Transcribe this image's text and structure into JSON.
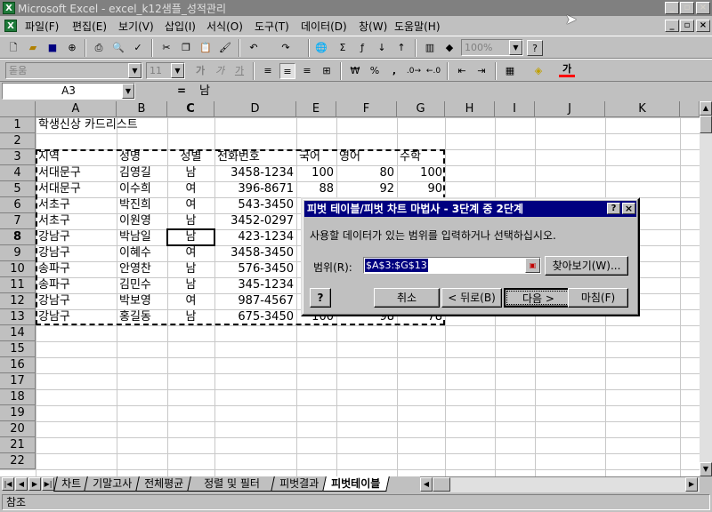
{
  "window": {
    "title": "Microsoft Excel - excel_k12샘플_성적관리",
    "app_icon": "X"
  },
  "menu": [
    "파일(F)",
    "편집(E)",
    "보기(V)",
    "삽입(I)",
    "서식(O)",
    "도구(T)",
    "데이터(D)",
    "창(W)",
    "도움말(H)"
  ],
  "toolbar": {
    "zoom": "100%"
  },
  "format_toolbar": {
    "font": "돋움",
    "size": "11",
    "bold": "가",
    "italic": "가",
    "underline": "가",
    "currency": "₩",
    "percent": "%",
    "comma": ",",
    "font_color_glyph": "가"
  },
  "formula_bar": {
    "name_box": "A3",
    "equals": "=",
    "value": "남"
  },
  "columns": [
    "A",
    "B",
    "C",
    "D",
    "E",
    "F",
    "G",
    "H",
    "I",
    "J",
    "K"
  ],
  "rows": [
    "1",
    "2",
    "3",
    "4",
    "5",
    "6",
    "7",
    "8",
    "9",
    "10",
    "11",
    "12",
    "13",
    "14",
    "15",
    "16",
    "17",
    "18",
    "19",
    "20",
    "21",
    "22"
  ],
  "sheet": {
    "title": "학생신상 카드리스트",
    "headers": [
      "지역",
      "성명",
      "성별",
      "전화번호",
      "국어",
      "영어",
      "수학"
    ],
    "data": [
      [
        "서대문구",
        "김영길",
        "남",
        "3458-1234",
        "100",
        "80",
        "100"
      ],
      [
        "서대문구",
        "이수희",
        "여",
        "396-8671",
        "88",
        "92",
        "90"
      ],
      [
        "서초구",
        "박진희",
        "여",
        "543-3450",
        "",
        "",
        ""
      ],
      [
        "서초구",
        "이원영",
        "남",
        "3452-0297",
        "",
        "",
        ""
      ],
      [
        "강남구",
        "박남일",
        "남",
        "423-1234",
        "",
        "",
        ""
      ],
      [
        "강남구",
        "이혜수",
        "여",
        "3458-3450",
        "",
        "",
        ""
      ],
      [
        "송파구",
        "안영찬",
        "남",
        "576-3450",
        "",
        "",
        ""
      ],
      [
        "송파구",
        "김민수",
        "남",
        "345-1234",
        "",
        "",
        ""
      ],
      [
        "강남구",
        "박보영",
        "여",
        "987-4567",
        "",
        "",
        ""
      ],
      [
        "강남구",
        "홍길동",
        "남",
        "675-3450",
        "100",
        "98",
        "78"
      ]
    ]
  },
  "tabs": [
    "차트",
    "기말고사",
    "전체평균",
    "정렬 및 필터",
    "피벗결과",
    "피벗테이블"
  ],
  "active_tab": "피벗테이블",
  "status": "참조",
  "dialog": {
    "title": "피벗 테이블/피벗 차트 마법사 - 3단계 중 2단계",
    "help_glyph": "?",
    "close_glyph": "×",
    "instruction": "사용할 데이터가 있는 범위를 입력하거나 선택하십시오.",
    "range_label": "범위(R):",
    "range_value": "$A$3:$G$13",
    "browse": "찾아보기(W)...",
    "cancel": "취소",
    "back": "< 뒤로(B)",
    "next": "다음 >",
    "finish": "마침(F)"
  }
}
